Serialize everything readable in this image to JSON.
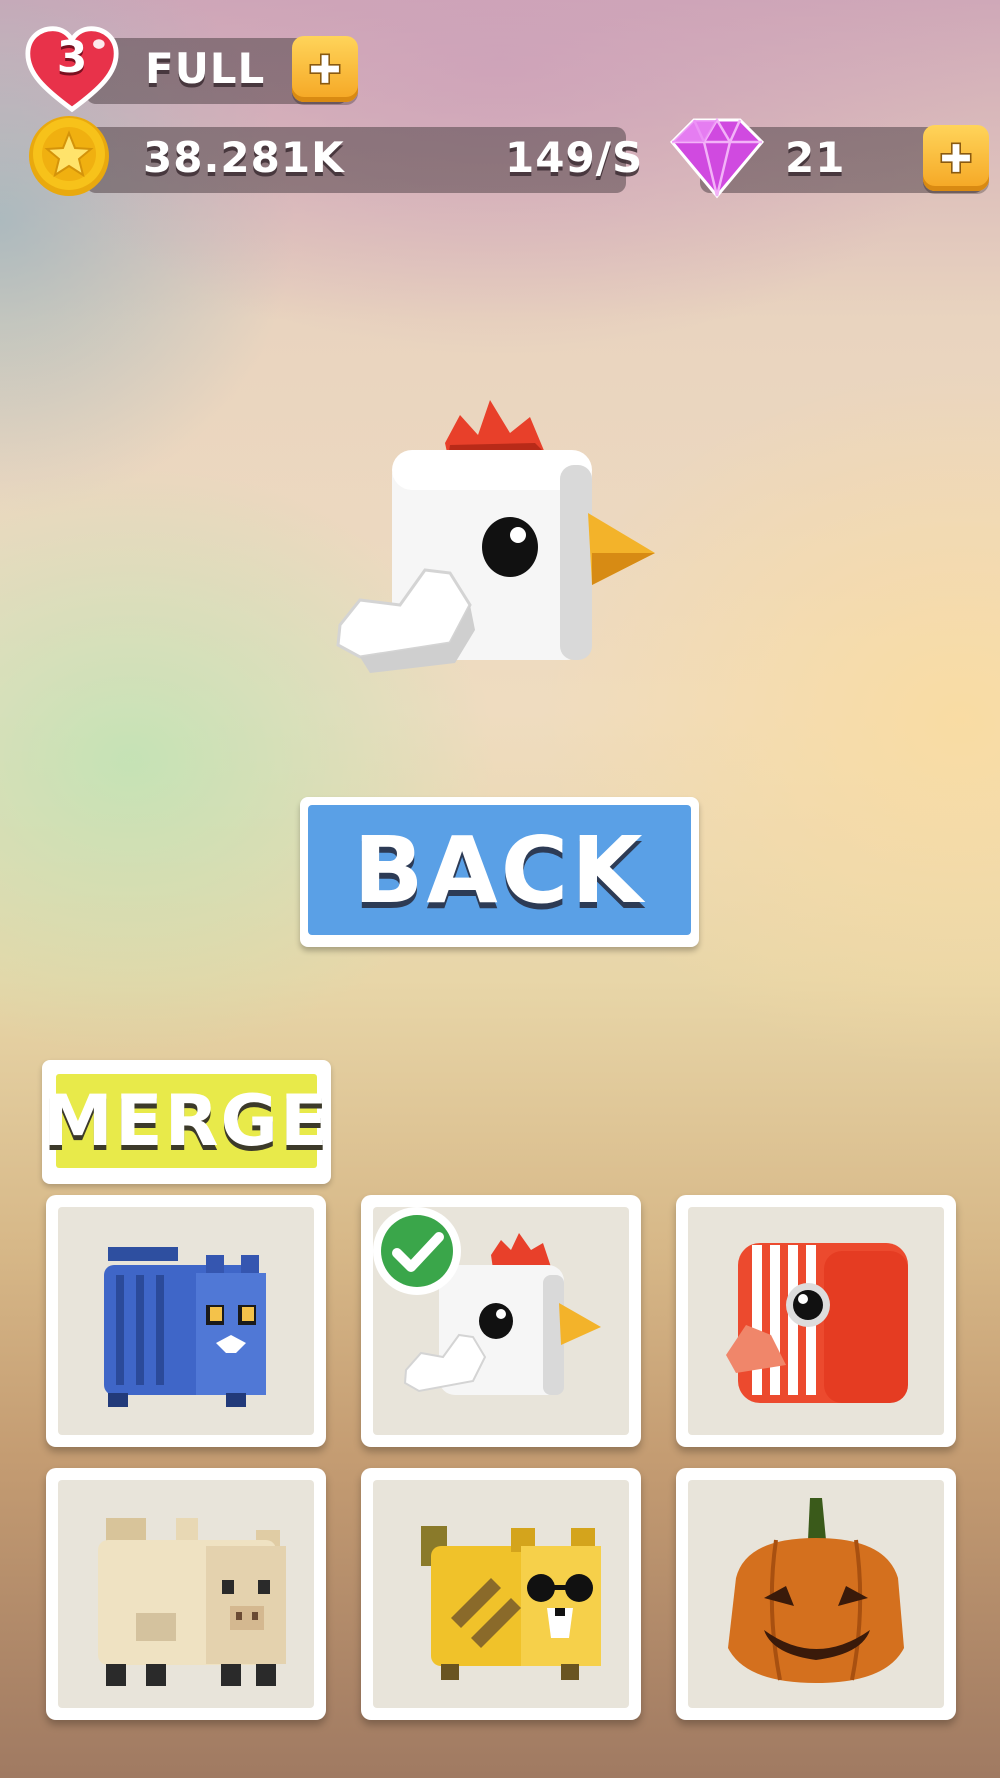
{
  "hud": {
    "lives_count": "3",
    "lives_status": "FULL",
    "coins": "38.281K",
    "coin_rate": "149/S",
    "gems": "21"
  },
  "preview": {
    "character": "chicken"
  },
  "buttons": {
    "back_label": "BACK",
    "merge_label": "MERGE"
  },
  "inventory": [
    {
      "character": "blue-cat",
      "selected": false
    },
    {
      "character": "chicken",
      "selected": true
    },
    {
      "character": "red-striped-bird",
      "selected": false
    },
    {
      "character": "tan-pig",
      "selected": false
    },
    {
      "character": "yellow-dog-sunglasses",
      "selected": false
    },
    {
      "character": "pumpkin",
      "selected": false
    }
  ],
  "colors": {
    "back_button": "#5aa0e6",
    "merge_button": "#e8ea4a",
    "plus_button": "#f5a623",
    "heart": "#e8324a",
    "gem": "#d04ae0",
    "coin": "#f7c21a"
  }
}
